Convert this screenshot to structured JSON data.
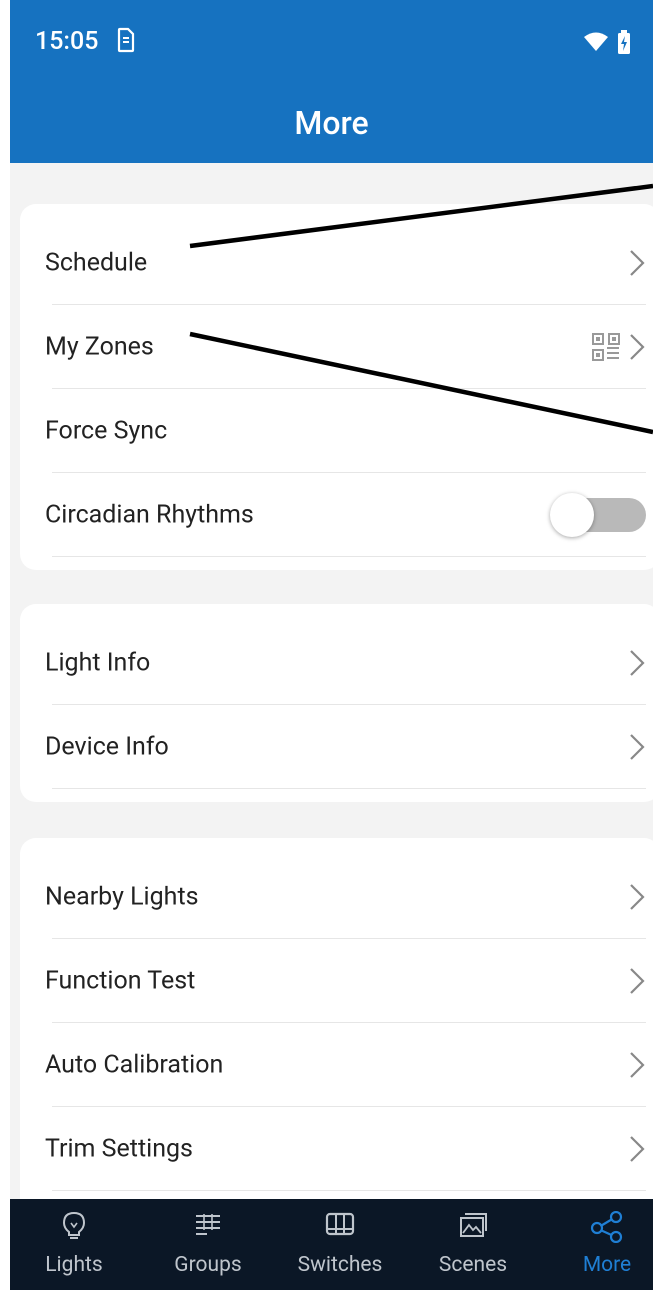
{
  "status_bar": {
    "time": "15:05",
    "sim_icon": "sim-icon",
    "wifi_icon": "wifi-icon",
    "battery_icon": "battery-charging-icon"
  },
  "header": {
    "title": "More"
  },
  "cards": [
    {
      "items": [
        {
          "label": "Schedule",
          "trailing": "chevron"
        },
        {
          "label": "My Zones",
          "trailing": "qr-chevron"
        },
        {
          "label": "Force Sync",
          "trailing": "none"
        },
        {
          "label": "Circadian Rhythms",
          "trailing": "toggle",
          "toggle_on": false
        }
      ]
    },
    {
      "items": [
        {
          "label": "Light Info",
          "trailing": "chevron"
        },
        {
          "label": "Device Info",
          "trailing": "chevron"
        }
      ]
    },
    {
      "items": [
        {
          "label": "Nearby Lights",
          "trailing": "chevron"
        },
        {
          "label": "Function Test",
          "trailing": "chevron"
        },
        {
          "label": "Auto Calibration",
          "trailing": "chevron"
        },
        {
          "label": "Trim Settings",
          "trailing": "chevron"
        }
      ]
    }
  ],
  "tabs": [
    {
      "label": "Lights",
      "icon": "bulb-icon",
      "active": false
    },
    {
      "label": "Groups",
      "icon": "groups-icon",
      "active": false
    },
    {
      "label": "Switches",
      "icon": "switch-icon",
      "active": false
    },
    {
      "label": "Scenes",
      "icon": "scenes-icon",
      "active": false
    },
    {
      "label": "More",
      "icon": "share-icon",
      "active": true
    }
  ],
  "colors": {
    "header": "#1672c0",
    "tabbar": "#0b1726",
    "tab_active": "#1f7fd4",
    "tab_inactive": "#bfc5cc",
    "background": "#f3f3f3"
  }
}
